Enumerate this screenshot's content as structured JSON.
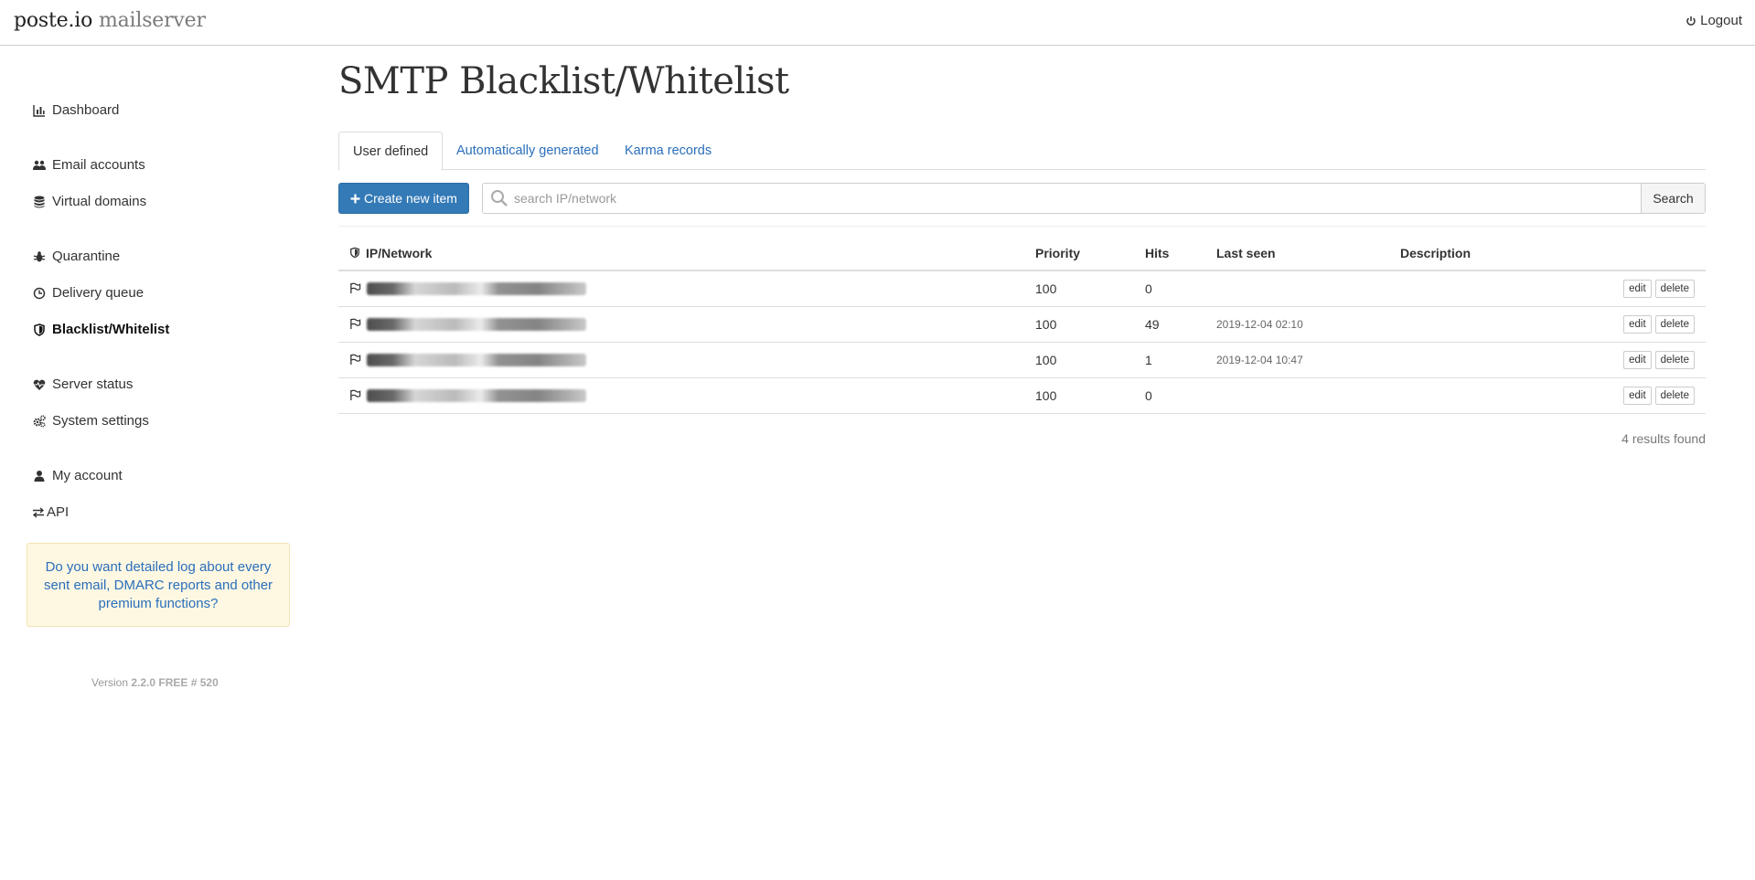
{
  "header": {
    "brand_main": "poste.io",
    "brand_sub": "mailserver",
    "logout_label": "Logout"
  },
  "sidebar": {
    "items": [
      {
        "label": "Dashboard",
        "icon": "bar-chart-icon"
      },
      {
        "label": "Email accounts",
        "icon": "users-icon"
      },
      {
        "label": "Virtual domains",
        "icon": "database-icon"
      },
      {
        "label": "Quarantine",
        "icon": "bug-icon"
      },
      {
        "label": "Delivery queue",
        "icon": "clock-icon"
      },
      {
        "label": "Blacklist/Whitelist",
        "icon": "shield-icon",
        "active": true
      },
      {
        "label": "Server status",
        "icon": "heartbeat-icon"
      },
      {
        "label": "System settings",
        "icon": "cogs-icon"
      },
      {
        "label": "My account",
        "icon": "user-icon"
      },
      {
        "label": "API",
        "icon": "exchange-icon"
      }
    ],
    "promo_text": "Do you want detailed log about every sent email, DMARC reports and other premium functions?",
    "version_prefix": "Version",
    "version_value": "2.2.0 FREE # 520"
  },
  "main": {
    "title": "SMTP Blacklist/Whitelist",
    "tabs": [
      {
        "label": "User defined",
        "active": true
      },
      {
        "label": "Automatically generated"
      },
      {
        "label": "Karma records"
      }
    ],
    "create_label": "Create new item",
    "search_placeholder": "search IP/network",
    "search_button": "Search",
    "columns": [
      "IP/Network",
      "Priority",
      "Hits",
      "Last seen",
      "Description"
    ],
    "rows": [
      {
        "priority": "100",
        "hits": "0",
        "last_seen": "",
        "description": ""
      },
      {
        "priority": "100",
        "hits": "49",
        "last_seen": "2019-12-04 02:10",
        "description": ""
      },
      {
        "priority": "100",
        "hits": "1",
        "last_seen": "2019-12-04 10:47",
        "description": ""
      },
      {
        "priority": "100",
        "hits": "0",
        "last_seen": "",
        "description": ""
      }
    ],
    "edit_label": "edit",
    "delete_label": "delete",
    "results_text": "4 results found"
  }
}
